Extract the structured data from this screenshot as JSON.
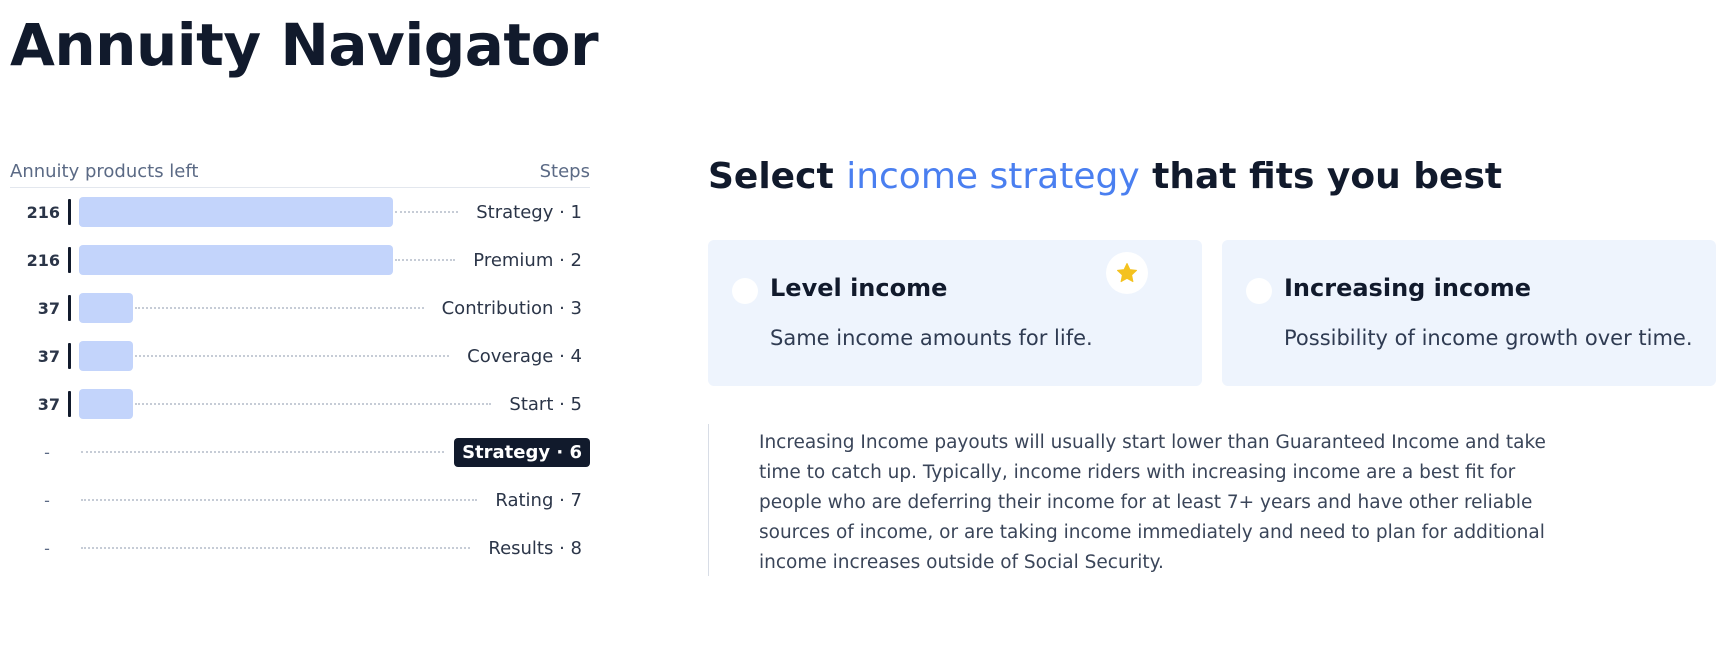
{
  "app": {
    "title": "Annuity Navigator"
  },
  "progress": {
    "header_left": "Annuity products left",
    "header_right": "Steps",
    "max_count": 216,
    "steps": [
      {
        "count": "216",
        "label": "Strategy · 1",
        "value": 216,
        "active": false
      },
      {
        "count": "216",
        "label": "Premium · 2",
        "value": 216,
        "active": false
      },
      {
        "count": "37",
        "label": "Contribution · 3",
        "value": 37,
        "active": false
      },
      {
        "count": "37",
        "label": "Coverage · 4",
        "value": 37,
        "active": false
      },
      {
        "count": "37",
        "label": "Start · 5",
        "value": 37,
        "active": false
      },
      {
        "count": "-",
        "label": "Strategy · 6",
        "value": 0,
        "active": true
      },
      {
        "count": "-",
        "label": "Rating · 7",
        "value": 0,
        "active": false
      },
      {
        "count": "-",
        "label": "Results · 8",
        "value": 0,
        "active": false
      }
    ]
  },
  "question": {
    "title_pre": "Select ",
    "title_accent": "income strategy",
    "title_post": " that fits you best"
  },
  "options": [
    {
      "title": "Level income",
      "description": "Same income amounts for life.",
      "recommended": true,
      "icon": "star-icon"
    },
    {
      "title": "Increasing income",
      "description": "Possibility of income growth over time.",
      "recommended": false
    }
  ],
  "info": {
    "text": "Increasing Income payouts will usually start lower than Guaranteed Income and take time to catch up. Typically, income riders with increasing income are a best fit for people who are deferring their income for at least 7+ years and have other reliable sources of income, or are taking income immediately and need to plan for additional income increases outside of Social Security."
  },
  "colors": {
    "accent": "#4a7ff0",
    "bar": "#c3d4fb",
    "card": "#eef4fd",
    "dark": "#111a2c",
    "star": "#f4c21f"
  }
}
